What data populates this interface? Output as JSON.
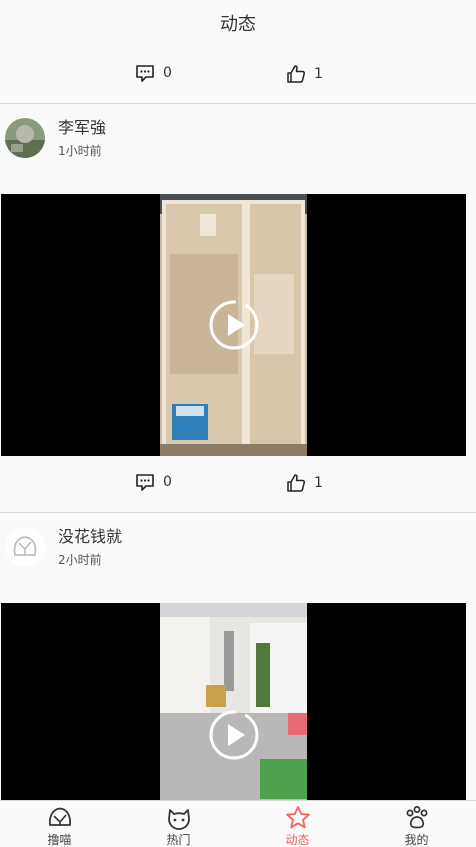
{
  "header": {
    "title": "动态"
  },
  "top_stats": {
    "comments": "0",
    "likes": "1"
  },
  "posts": [
    {
      "username": "李军強",
      "time": "1小时前",
      "comments": "0",
      "likes": "1"
    },
    {
      "username": "没花钱就",
      "time": "2小时前"
    }
  ],
  "tabs": [
    {
      "label": "撸喵",
      "icon": "cat-face-icon"
    },
    {
      "label": "热门",
      "icon": "cat-head-icon"
    },
    {
      "label": "动态",
      "icon": "star-icon"
    },
    {
      "label": "我的",
      "icon": "paw-icon"
    }
  ],
  "colors": {
    "accent": "#f0655b",
    "background": "#fafafa",
    "text": "#333333",
    "divider": "#d8d8d8"
  }
}
